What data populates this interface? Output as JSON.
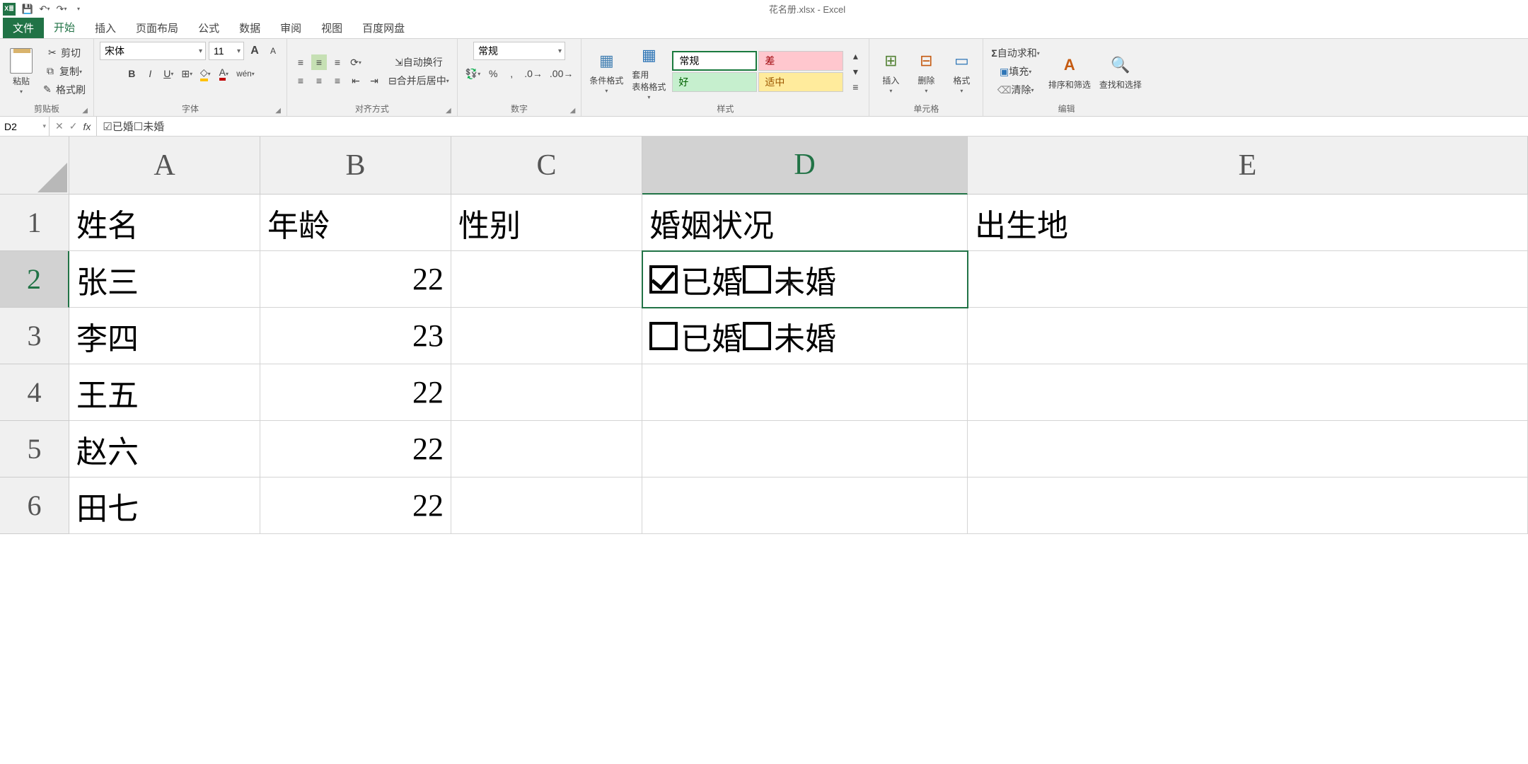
{
  "title": "花名册.xlsx - Excel",
  "tabs": {
    "file": "文件",
    "home": "开始",
    "insert": "插入",
    "layout": "页面布局",
    "formulas": "公式",
    "data": "数据",
    "review": "审阅",
    "view": "视图",
    "baidu": "百度网盘"
  },
  "clipboard": {
    "label": "剪贴板",
    "paste": "粘贴",
    "cut": "剪切",
    "copy": "复制",
    "fmtpaint": "格式刷"
  },
  "font": {
    "label": "字体",
    "name": "宋体",
    "size": "11"
  },
  "alignment": {
    "label": "对齐方式",
    "wrap": "自动换行",
    "merge": "合并后居中"
  },
  "number": {
    "label": "数字",
    "fmt": "常规"
  },
  "styles": {
    "label": "样式",
    "cond": "条件格式",
    "table": "套用\n表格格式",
    "normal": "常规",
    "bad": "差",
    "good": "好",
    "neutral": "适中"
  },
  "cells": {
    "label": "单元格",
    "insert": "插入",
    "delete": "删除",
    "format": "格式"
  },
  "editing": {
    "label": "编辑",
    "sum": "自动求和",
    "fill": "填充",
    "clear": "清除",
    "sort": "排序和筛选",
    "find": "查找和选择"
  },
  "nameBox": "D2",
  "formula": "☑已婚☐未婚",
  "cols": [
    "A",
    "B",
    "C",
    "D",
    "E"
  ],
  "rows": [
    "1",
    "2",
    "3",
    "4",
    "5",
    "6"
  ],
  "headers": {
    "A": "姓名",
    "B": "年龄",
    "C": "性别",
    "D": "婚姻状况",
    "E": "出生地"
  },
  "data": {
    "A": [
      "张三",
      "李四",
      "王五",
      "赵六",
      "田七"
    ],
    "B": [
      "22",
      "23",
      "22",
      "22",
      "22"
    ],
    "D2": {
      "married": true,
      "t1": "已婚",
      "single": false,
      "t2": "未婚"
    },
    "D3": {
      "married": false,
      "t1": "已婚",
      "single": false,
      "t2": "未婚"
    }
  },
  "chart_data": {
    "type": "table",
    "columns": [
      "姓名",
      "年龄",
      "性别",
      "婚姻状况",
      "出生地"
    ],
    "rows": [
      [
        "张三",
        22,
        "",
        "☑已婚☐未婚",
        ""
      ],
      [
        "李四",
        23,
        "",
        "☐已婚☐未婚",
        ""
      ],
      [
        "王五",
        22,
        "",
        "",
        ""
      ],
      [
        "赵六",
        22,
        "",
        "",
        ""
      ],
      [
        "田七",
        22,
        "",
        "",
        ""
      ]
    ]
  }
}
